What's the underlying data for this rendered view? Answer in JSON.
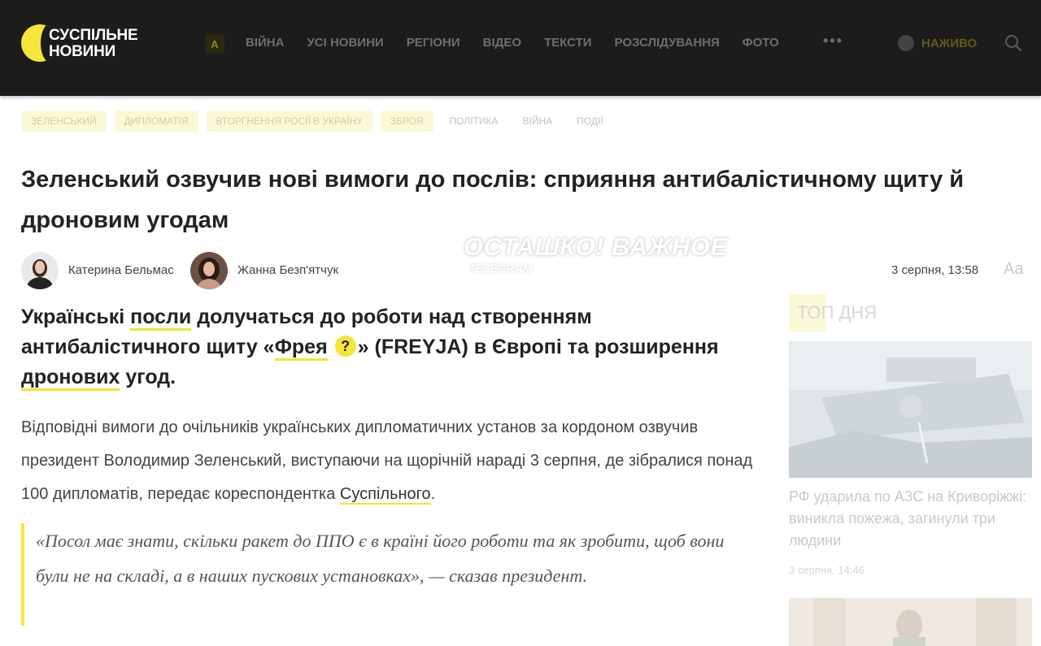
{
  "header": {
    "logo_line1": "СУСПІЛЬНЕ",
    "logo_line2": "НОВИНИ",
    "a_badge": "А",
    "nav": [
      "ВІЙНА",
      "УСІ НОВИНИ",
      "РЕГІОНИ",
      "ВІДЕО",
      "ТЕКСТИ",
      "РОЗСЛІДУВАННЯ",
      "ФОТО"
    ],
    "more": "•••",
    "live": "НАЖИВО"
  },
  "tags": {
    "highlighted": [
      "ЗЕЛЕНСЬКИЙ",
      "ДИПЛОМАТІЯ",
      "ВТОРГНЕННЯ РОСІЇ В УКРАЇНУ",
      "ЗБРОЯ"
    ],
    "plain": [
      "ПОЛІТИКА",
      "ВІЙНА",
      "ПОДІЇ"
    ]
  },
  "article": {
    "title": "Зеленський озвучив нові вимоги до послів: сприяння антибалістичному щиту й дроновим угодам",
    "authors": [
      "Катерина Бельмас",
      "Жанна Безп'ятчук"
    ],
    "date": "3 серпня, 13:58",
    "font_icon": "Aa",
    "lead": {
      "p1": "Українські ",
      "link1": "посли",
      "p2": " долучаться до роботи над створенням антибалістичного щиту «",
      "link2": "Фрея",
      "badge": "?",
      "p3": "» (FREYJA) в Європі та розширення ",
      "link3": "дронових",
      "p4": " угод."
    },
    "para": {
      "text": "Відповідні вимоги до очільників українських дипломатичних установ за кордоном озвучив президент Володимир Зеленський, виступаючи на щорічній нараді 3 серпня, де зібралися понад 100 дипломатів, передає кореспондентка ",
      "link": "Суспільного",
      "end": "."
    },
    "quote": "«Посол має знати, скільки ракет до ППО є в країні його роботи та як зробити, щоб вони були не на складі, а в наших пускових установках», — сказав президент."
  },
  "watermark": {
    "main": "ОСТАШКО! ВАЖНОЕ",
    "sub": "TELEGRAM"
  },
  "sidebar": {
    "label": "ТОП ДНЯ",
    "item1_title": "РФ ударила по АЗС на Криворіжжі: виникла пожежа, загинули три людини",
    "item1_time": "3 серпня, 14:46"
  }
}
